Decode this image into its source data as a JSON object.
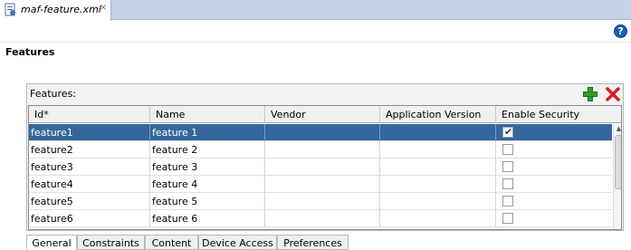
{
  "editor_tab": {
    "filename": "maf-feature.xml",
    "close_glyph": "×",
    "icon": "xml-file-icon"
  },
  "help": {
    "icon": "help-icon",
    "glyph": "?"
  },
  "page": {
    "title": "Features"
  },
  "panel": {
    "label": "Features:",
    "add_icon": "add-icon",
    "delete_icon": "delete-icon",
    "colors": {
      "add": "#2fa02f",
      "delete": "#d42020",
      "selection": "#34679c"
    }
  },
  "table": {
    "columns": [
      "Id*",
      "Name",
      "Vendor",
      "Application Version",
      "Enable Security"
    ],
    "rows": [
      {
        "id": "feature1",
        "name": "feature 1",
        "vendor": "",
        "app_version": "",
        "enable_security": true,
        "selected": true
      },
      {
        "id": "feature2",
        "name": "feature 2",
        "vendor": "",
        "app_version": "",
        "enable_security": false,
        "selected": false
      },
      {
        "id": "feature3",
        "name": "feature 3",
        "vendor": "",
        "app_version": "",
        "enable_security": false,
        "selected": false
      },
      {
        "id": "feature4",
        "name": "feature 4",
        "vendor": "",
        "app_version": "",
        "enable_security": false,
        "selected": false
      },
      {
        "id": "feature5",
        "name": "feature 5",
        "vendor": "",
        "app_version": "",
        "enable_security": false,
        "selected": false
      },
      {
        "id": "feature6",
        "name": "feature 6",
        "vendor": "",
        "app_version": "",
        "enable_security": false,
        "selected": false
      }
    ]
  },
  "bottom_tabs": {
    "items": [
      "General",
      "Constraints",
      "Content",
      "Device Access",
      "Preferences"
    ],
    "active": "General"
  }
}
